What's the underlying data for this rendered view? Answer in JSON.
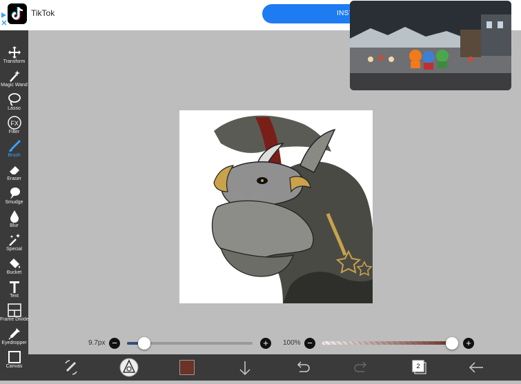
{
  "ad": {
    "app_name": "TikTok",
    "button_label": "INST"
  },
  "tools": [
    {
      "label": "Transform",
      "icon": "move-arrows-icon"
    },
    {
      "label": "Magic Wand",
      "icon": "magic-wand-icon"
    },
    {
      "label": "Lasso",
      "icon": "lasso-icon"
    },
    {
      "label": "Filter",
      "icon": "fx-filter-icon"
    },
    {
      "label": "Brush",
      "icon": "brush-icon",
      "active": true
    },
    {
      "label": "Eraser",
      "icon": "eraser-icon"
    },
    {
      "label": "Smudge",
      "icon": "smudge-icon"
    },
    {
      "label": "Blur",
      "icon": "droplet-icon"
    },
    {
      "label": "Special",
      "icon": "sparkle-wand-icon"
    },
    {
      "label": "Bucket",
      "icon": "paint-bucket-icon"
    },
    {
      "label": "Text",
      "icon": "text-t-icon"
    },
    {
      "label": "Frame Divider",
      "icon": "frame-divider-icon"
    },
    {
      "label": "Eyedropper",
      "icon": "eyedropper-icon"
    },
    {
      "label": "Canvas",
      "icon": "canvas-icon"
    }
  ],
  "brush": {
    "size_label": "9.7px",
    "size_fraction": 0.14,
    "opacity_label": "100%",
    "opacity_fraction": 1.0
  },
  "bottom_bar": {
    "color_hex": "#6b3228",
    "layers_count": "2"
  },
  "colors": {
    "accent": "#3aa0ff",
    "toolbar_bg": "#3a3a3a",
    "canvas_bg": "#bdbdbd",
    "slider_fill": "#2f4f7a"
  }
}
